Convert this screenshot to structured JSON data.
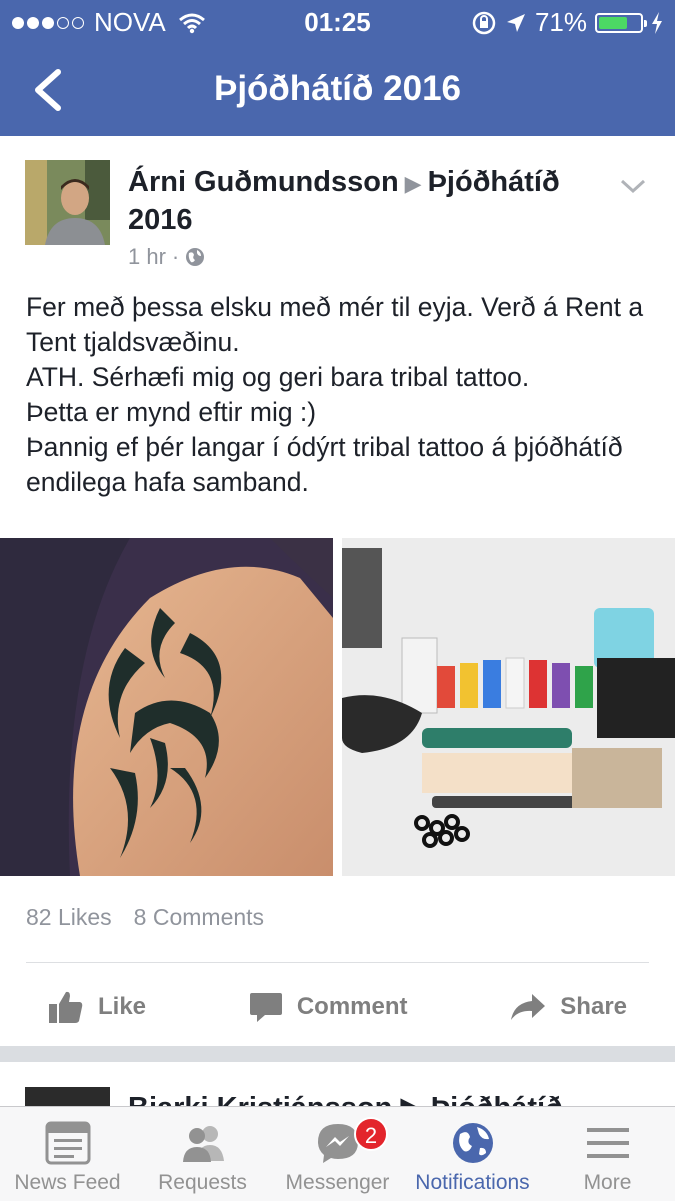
{
  "status_bar": {
    "carrier": "NOVA",
    "time": "01:25",
    "battery": "71%",
    "battery_level": 0.71
  },
  "nav": {
    "title": "Þjóðhátíð 2016"
  },
  "post": {
    "author": "Árni Guðmundsson",
    "group": "Þjóðhátíð 2016",
    "time": "1 hr",
    "lines": [
      "Fer með þessa elsku með mér til eyja. Verð á Rent a Tent tjaldsvæðinu.",
      "ATH. Sérhæfi mig og geri bara tribal tattoo.",
      "Þetta er mynd eftir mig :)",
      "Þannig ef þér langar í ódýrt tribal tattoo á þjóðhátíð endilega hafa samband."
    ],
    "likes": "82 Likes",
    "comments": "8 Comments",
    "actions": {
      "like": "Like",
      "comment": "Comment",
      "share": "Share"
    }
  },
  "next_post": {
    "author_partial": "Bjarki Kristjánsson ▶ Þjóðhátíð"
  },
  "tab_bar": {
    "tabs": [
      {
        "label": "News Feed",
        "icon": "news-feed-icon"
      },
      {
        "label": "Requests",
        "icon": "friend-requests-icon"
      },
      {
        "label": "Messenger",
        "icon": "messenger-icon",
        "badge": "2"
      },
      {
        "label": "Notifications",
        "icon": "globe-icon",
        "active": true
      },
      {
        "label": "More",
        "icon": "hamburger-icon"
      }
    ]
  },
  "colors": {
    "brand": "#4a67ad",
    "badge": "#e3252c",
    "battery": "#4cd964"
  }
}
